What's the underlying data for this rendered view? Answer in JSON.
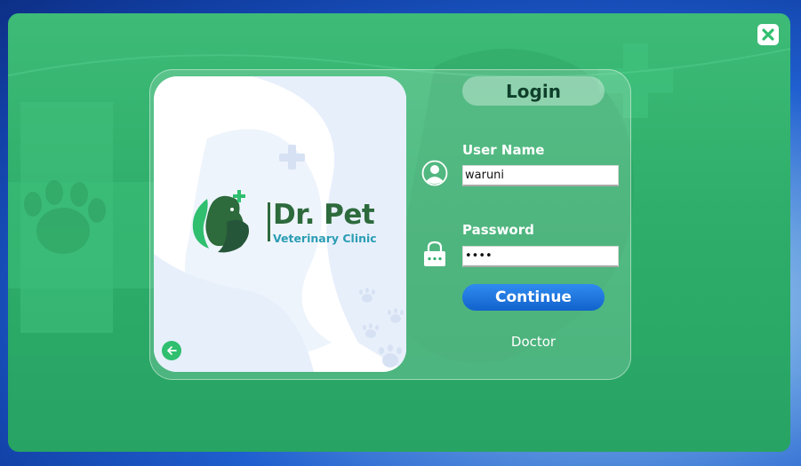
{
  "window": {
    "close_icon": "close-x-icon"
  },
  "brand": {
    "title": "Dr. Pet",
    "subtitle": "Veterinary Clinic"
  },
  "logo_panel": {
    "back_icon": "arrow-left-icon"
  },
  "login": {
    "heading": "Login",
    "username_label": "User Name",
    "username_value": "waruni",
    "password_label": "Password",
    "password_value": "••••",
    "continue_label": "Continue",
    "role": "Doctor"
  },
  "colors": {
    "window_green": "#2eae6a",
    "button_blue": "#1a73e0",
    "brand_green": "#2d6a3c",
    "brand_teal": "#2a9db4"
  }
}
